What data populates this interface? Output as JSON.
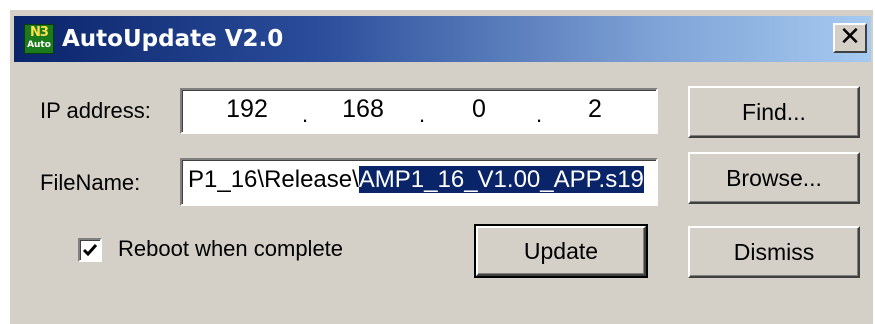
{
  "window": {
    "title": "AutoUpdate V2.0",
    "icon": {
      "name": "app-logo-icon",
      "top_text": "N3",
      "bottom_text": "Auto"
    },
    "close_label": "✕"
  },
  "form": {
    "ip_label": "IP address:",
    "ip_octets": [
      "192",
      "168",
      "0",
      "2"
    ],
    "filename_label": "FileName:",
    "filename_unselected": "P1_16\\Release\\",
    "filename_selected": "AMP1_16_V1.00_APP.s19",
    "reboot_label": "Reboot when complete",
    "reboot_checked": true
  },
  "buttons": {
    "find": "Find...",
    "browse": "Browse...",
    "update": "Update",
    "dismiss": "Dismiss"
  },
  "colors": {
    "title_start": "#0a246a",
    "title_end": "#a6caf0",
    "selection": "#0a246a",
    "face": "#d4d0c8"
  }
}
